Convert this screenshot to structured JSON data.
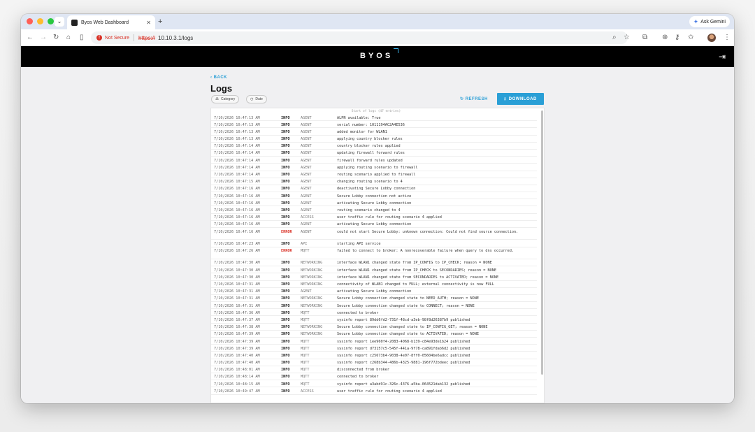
{
  "browser": {
    "tab_title": "Byos Web Dashboard",
    "ask_gemini": "Ask Gemini",
    "not_secure": "Not Secure",
    "url_scheme": "https://",
    "url_rest": "10.10.3.1/logs",
    "colors": {
      "tab_strip": "#dfe6f3",
      "close": "#ff5f57",
      "minimize": "#febc2e",
      "maximize": "#28c840",
      "warning": "#d93025"
    }
  },
  "app": {
    "brand": "BYOS",
    "colors": {
      "header": "#000000",
      "accent": "#2a9fd6",
      "error": "#d93025"
    }
  },
  "page": {
    "back_label": "BACK",
    "title": "Logs",
    "filter_category": "Category",
    "filter_date": "Date",
    "refresh_label": "REFRESH",
    "download_label": "DOWNLOAD"
  },
  "logs": {
    "start_label": "Start of logs (47 entries)",
    "rows": [
      {
        "time": "7/10/2026 10:47:13 AM",
        "level": "INFO",
        "cat": "AGENT",
        "msg": "ALPN available: True"
      },
      {
        "time": "7/10/2026 10:47:13 AM",
        "level": "INFO",
        "cat": "AGENT",
        "msg": "serial number: 1011194AC2A4E536"
      },
      {
        "time": "7/10/2026 10:47:13 AM",
        "level": "INFO",
        "cat": "AGENT",
        "msg": "added monitor for WLAN1"
      },
      {
        "time": "7/10/2026 10:47:13 AM",
        "level": "INFO",
        "cat": "AGENT",
        "msg": "applying country blocker rules"
      },
      {
        "time": "7/10/2026 10:47:14 AM",
        "level": "INFO",
        "cat": "AGENT",
        "msg": "country blocker rules applied"
      },
      {
        "time": "7/10/2026 10:47:14 AM",
        "level": "INFO",
        "cat": "AGENT",
        "msg": "updating firewall forward rules"
      },
      {
        "time": "7/10/2026 10:47:14 AM",
        "level": "INFO",
        "cat": "AGENT",
        "msg": "firewall forward rules updated"
      },
      {
        "time": "7/10/2026 10:47:14 AM",
        "level": "INFO",
        "cat": "AGENT",
        "msg": "applying routing scenario to firewall"
      },
      {
        "time": "7/10/2026 10:47:14 AM",
        "level": "INFO",
        "cat": "AGENT",
        "msg": "routing scenario applied to firewall"
      },
      {
        "time": "7/10/2026 10:47:15 AM",
        "level": "INFO",
        "cat": "AGENT",
        "msg": "changing routing scenario to 4"
      },
      {
        "time": "7/10/2026 10:47:16 AM",
        "level": "INFO",
        "cat": "AGENT",
        "msg": "deactivating Secure Lobby connection"
      },
      {
        "time": "7/10/2026 10:47:16 AM",
        "level": "INFO",
        "cat": "AGENT",
        "msg": "Secure Lobby connection not active"
      },
      {
        "time": "7/10/2026 10:47:16 AM",
        "level": "INFO",
        "cat": "AGENT",
        "msg": "activating Secure Lobby connection"
      },
      {
        "time": "7/10/2026 10:47:16 AM",
        "level": "INFO",
        "cat": "AGENT",
        "msg": "routing scenario changed to 4"
      },
      {
        "time": "7/10/2026 10:47:16 AM",
        "level": "INFO",
        "cat": "ACCESS",
        "msg": "user traffic rule for routing scenario 4 applied"
      },
      {
        "time": "7/10/2026 10:47:16 AM",
        "level": "INFO",
        "cat": "AGENT",
        "msg": "activating Secure Lobby connection"
      },
      {
        "time": "7/10/2026 10:47:16 AM",
        "level": "ERROR",
        "cat": "AGENT",
        "msg": "could not start Secure Lobby: unknown connection: Could not find source connection."
      },
      {
        "time": "7/10/2026 10:47:23 AM",
        "level": "INFO",
        "cat": "API",
        "msg": "starting API service"
      },
      {
        "time": "7/10/2026 10:47:26 AM",
        "level": "ERROR",
        "cat": "MQTT",
        "msg": "failed to connect to broker: A nonrecoverable failure when query to dns occurred."
      },
      {
        "time": "7/10/2026 10:47:30 AM",
        "level": "INFO",
        "cat": "NETWORKING",
        "msg": "interface WLAN1 changed state from IP_CONFIG to IP_CHECK; reason = NONE"
      },
      {
        "time": "7/10/2026 10:47:30 AM",
        "level": "INFO",
        "cat": "NETWORKING",
        "msg": "interface WLAN1 changed state from IP_CHECK to SECONDARIES; reason = NONE"
      },
      {
        "time": "7/10/2026 10:47:30 AM",
        "level": "INFO",
        "cat": "NETWORKING",
        "msg": "interface WLAN1 changed state from SECONDARIES to ACTIVATED; reason = NONE"
      },
      {
        "time": "7/10/2026 10:47:31 AM",
        "level": "INFO",
        "cat": "NETWORKING",
        "msg": "connectivity of WLAN1 changed to FULL; external connectivity is now FULL"
      },
      {
        "time": "7/10/2026 10:47:31 AM",
        "level": "INFO",
        "cat": "AGENT",
        "msg": "activating Secure Lobby connection"
      },
      {
        "time": "7/10/2026 10:47:31 AM",
        "level": "INFO",
        "cat": "NETWORKING",
        "msg": "Secure Lobby connection changed state to NEED_AUTH; reason = NONE"
      },
      {
        "time": "7/10/2026 10:47:31 AM",
        "level": "INFO",
        "cat": "NETWORKING",
        "msg": "Secure Lobby connection changed state to CONNECT; reason = NONE"
      },
      {
        "time": "7/10/2026 10:47:36 AM",
        "level": "INFO",
        "cat": "MQTT",
        "msg": "connected to broker"
      },
      {
        "time": "7/10/2026 10:47:37 AM",
        "level": "INFO",
        "cat": "MQTT",
        "msg": "sysinfo report 89dd6fd2-731f-48cd-a3eb-98f8d26387b9 published"
      },
      {
        "time": "7/10/2026 10:47:38 AM",
        "level": "INFO",
        "cat": "NETWORKING",
        "msg": "Secure Lobby connection changed state to IP_CONFIG_GET; reason = NONE"
      },
      {
        "time": "7/10/2026 10:47:39 AM",
        "level": "INFO",
        "cat": "NETWORKING",
        "msg": "Secure Lobby connection changed state to ACTIVATED; reason = NONE"
      },
      {
        "time": "7/10/2026 10:47:39 AM",
        "level": "INFO",
        "cat": "MQTT",
        "msg": "sysinfo report 1ee960f4-2083-4068-b139-c84e93de1b24 published"
      },
      {
        "time": "7/10/2026 10:47:39 AM",
        "level": "INFO",
        "cat": "MQTT",
        "msg": "sysinfo report d73157c5-545f-441a-9f78-ca891fdab6d2 published"
      },
      {
        "time": "7/10/2026 10:47:40 AM",
        "level": "INFO",
        "cat": "MQTT",
        "msg": "sysinfo report c25673b4-9038-4e07-8ff0-05604be6adcc published"
      },
      {
        "time": "7/10/2026 10:47:40 AM",
        "level": "INFO",
        "cat": "MQTT",
        "msg": "sysinfo report c268b344-486b-4325-9881-196f772bdeec published"
      },
      {
        "time": "7/10/2026 10:48:01 AM",
        "level": "INFO",
        "cat": "MQTT",
        "msg": "disconnected from broker"
      },
      {
        "time": "7/10/2026 10:48:14 AM",
        "level": "INFO",
        "cat": "MQTT",
        "msg": "connected to broker"
      },
      {
        "time": "7/10/2026 10:48:15 AM",
        "level": "INFO",
        "cat": "MQTT",
        "msg": "sysinfo report a3abd91c-326c-4376-a5ba-064521dab132 published"
      },
      {
        "time": "7/10/2026 10:49:47 AM",
        "level": "INFO",
        "cat": "ACCESS",
        "msg": "user traffic rule for routing scenario 4 applied"
      }
    ]
  }
}
